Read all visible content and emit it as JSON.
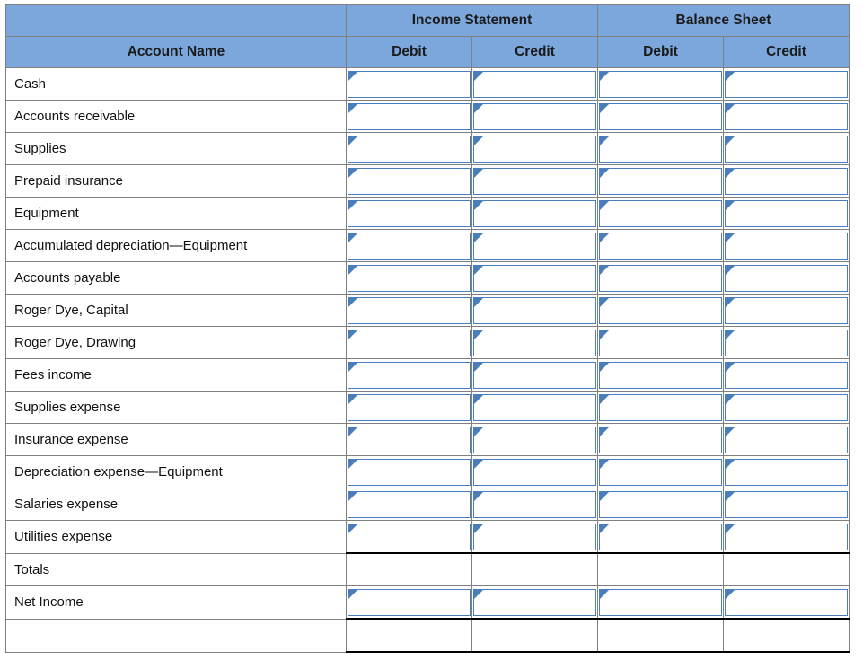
{
  "worksheet": {
    "column_groups": [
      {
        "label": "Income Statement",
        "span": 2
      },
      {
        "label": "Balance Sheet",
        "span": 2
      }
    ],
    "headers": {
      "account_name": "Account Name",
      "is_debit": "Debit",
      "is_credit": "Credit",
      "bs_debit": "Debit",
      "bs_credit": "Credit"
    },
    "rows": [
      {
        "name": "Cash",
        "inputs": true
      },
      {
        "name": "Accounts receivable",
        "inputs": true
      },
      {
        "name": "Supplies",
        "inputs": true
      },
      {
        "name": "Prepaid insurance",
        "inputs": true
      },
      {
        "name": "Equipment",
        "inputs": true
      },
      {
        "name": "Accumulated depreciation—Equipment",
        "inputs": true
      },
      {
        "name": "Accounts payable",
        "inputs": true
      },
      {
        "name": "Roger Dye, Capital",
        "inputs": true
      },
      {
        "name": "Roger Dye, Drawing",
        "inputs": true
      },
      {
        "name": "Fees income",
        "inputs": true
      },
      {
        "name": "Supplies expense",
        "inputs": true
      },
      {
        "name": "Insurance expense",
        "inputs": true
      },
      {
        "name": "Depreciation expense—Equipment",
        "inputs": true
      },
      {
        "name": "Salaries expense",
        "inputs": true
      },
      {
        "name": "Utilities expense",
        "inputs": true
      }
    ],
    "totals_row": {
      "name": "Totals",
      "inputs": false
    },
    "net_income_row": {
      "name": "Net Income",
      "inputs": true
    },
    "closing_row": {
      "name": "",
      "inputs": false
    },
    "values": {
      "is_debit": "",
      "is_credit": "",
      "bs_debit": "",
      "bs_credit": ""
    },
    "colors": {
      "header_fill": "#7BA7DC",
      "grid_line": "#808080",
      "input_border": "#4A7EBB",
      "rule_line": "#000000",
      "text": "#111111"
    }
  }
}
